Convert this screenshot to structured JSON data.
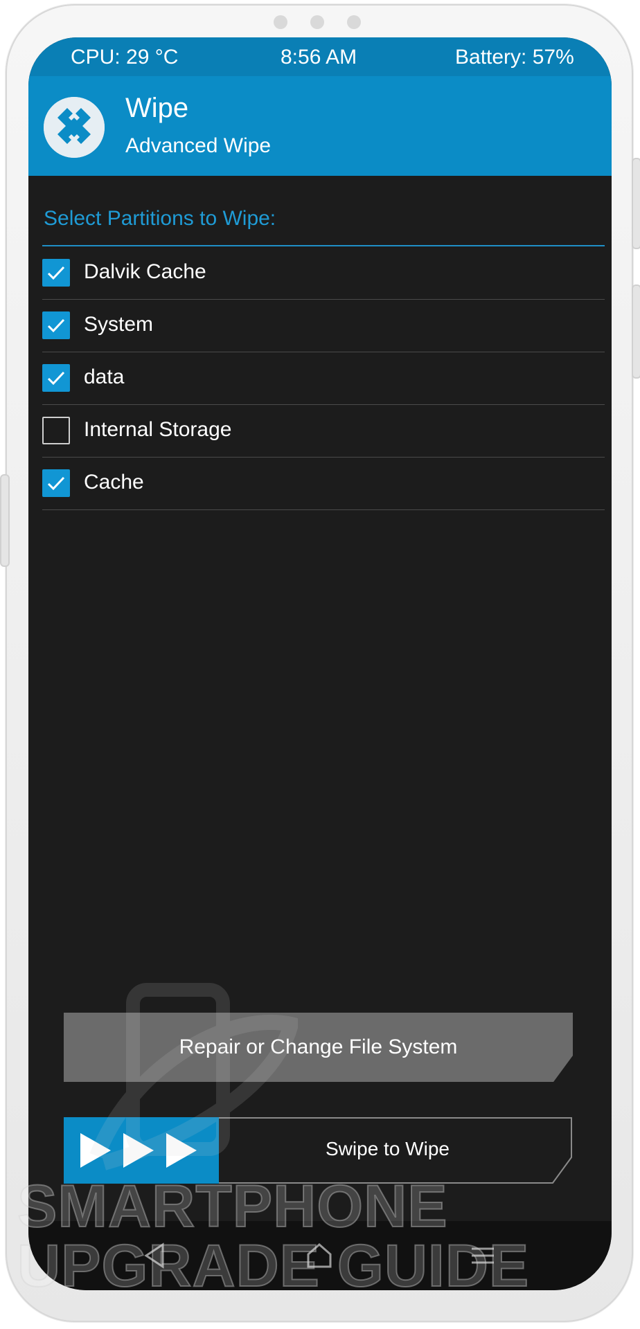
{
  "status_bar": {
    "cpu": "CPU: 29 °C",
    "time": "8:56 AM",
    "battery": "Battery: 57%"
  },
  "header": {
    "title": "Wipe",
    "subtitle": "Advanced Wipe"
  },
  "section_label": "Select Partitions to Wipe:",
  "partitions": [
    {
      "label": "Dalvik Cache",
      "checked": true
    },
    {
      "label": "System",
      "checked": true
    },
    {
      "label": "data",
      "checked": true
    },
    {
      "label": "Internal Storage",
      "checked": false
    },
    {
      "label": "Cache",
      "checked": true
    }
  ],
  "buttons": {
    "repair_label": "Repair or Change File System",
    "swipe_label": "Swipe to Wipe"
  },
  "navigation": [
    "back-icon",
    "home-icon",
    "menu-icon"
  ],
  "watermark": {
    "line1": "SMARTPHONE",
    "line2": "UPGRADE GUIDE"
  },
  "colors": {
    "accent": "#0b8cc6",
    "statusbar": "#0a7fb5",
    "background": "#1c1c1c",
    "button": "#6b6b6b"
  }
}
